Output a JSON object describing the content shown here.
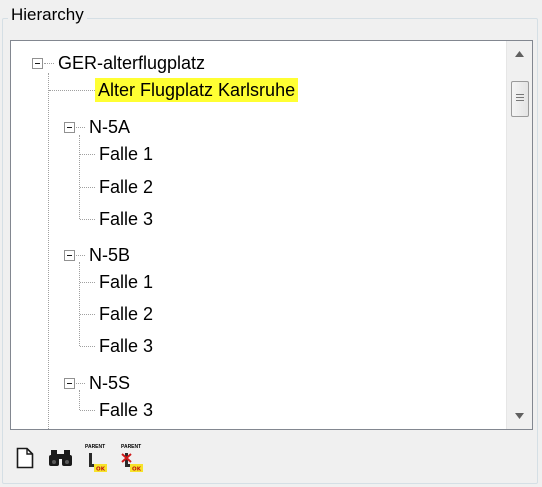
{
  "group": {
    "title": "Hierarchy"
  },
  "tree": {
    "root": "GER-alterflugplatz",
    "selected_node": "Alter Flugplatz Karlsruhe",
    "nodes": [
      {
        "label": "N-5A",
        "children": [
          "Falle 1",
          "Falle 2",
          "Falle 3"
        ]
      },
      {
        "label": "N-5B",
        "children": [
          "Falle 1",
          "Falle 2",
          "Falle 3"
        ]
      },
      {
        "label": "N-5S",
        "children": [
          "Falle 3"
        ]
      }
    ]
  },
  "toolbar": {
    "buttons": [
      {
        "icon": "new-document-icon"
      },
      {
        "icon": "binoculars-find-icon"
      },
      {
        "icon": "parent-ok-icon",
        "caption": "PARENT",
        "badge": "OK"
      },
      {
        "icon": "parent-cancel-icon",
        "caption": "PARENT",
        "badge": "OK"
      }
    ]
  },
  "colors": {
    "selection": "#ffff33",
    "tree_lines": "#a0a0a0",
    "border": "#828790"
  }
}
